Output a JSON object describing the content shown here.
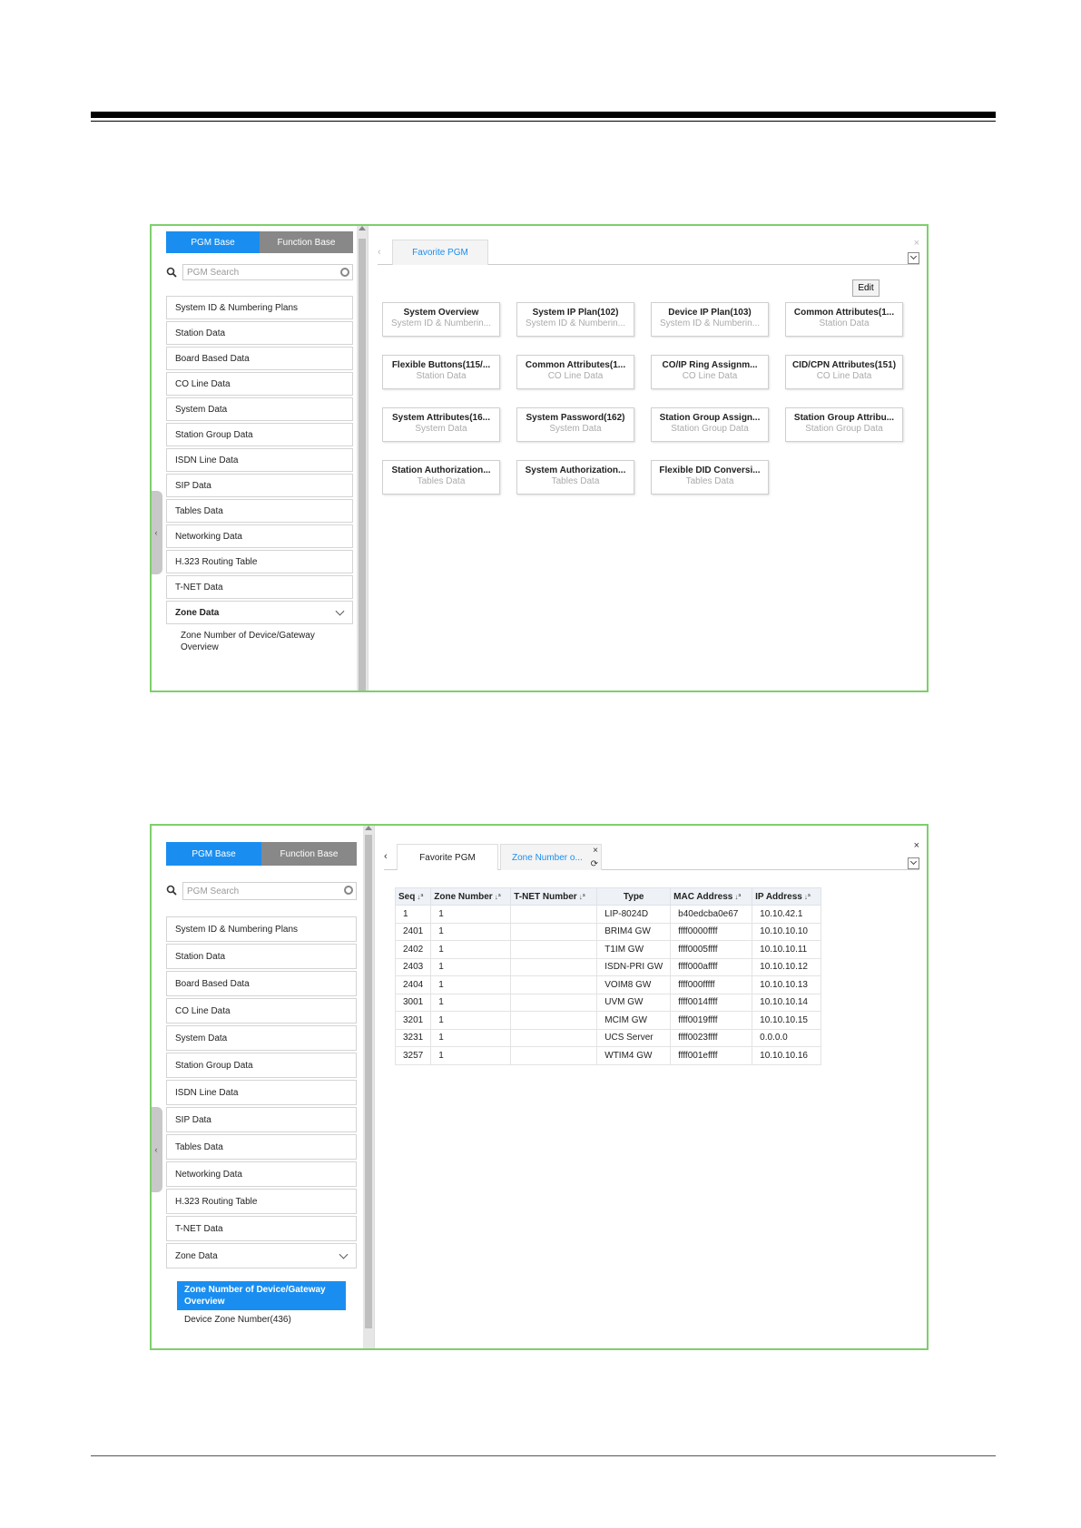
{
  "left_panel": {
    "tabs": [
      "PGM Base",
      "Function Base"
    ],
    "search_placeholder": "PGM Search",
    "menu": [
      "System ID & Numbering Plans",
      "Station Data",
      "Board Based Data",
      "CO Line Data",
      "System Data",
      "Station Group Data",
      "ISDN Line Data",
      "SIP Data",
      "Tables Data",
      "Networking Data",
      "H.323 Routing Table",
      "T-NET Data"
    ],
    "zone_menu": "Zone Data",
    "zone_sub": "Zone Number of Device/Gateway Overview",
    "zone_sub2": "Device Zone Number(436)"
  },
  "screen1": {
    "tab": "Favorite PGM",
    "edit_label": "Edit",
    "cards": [
      {
        "title": "System Overview",
        "subtitle": "System ID & Numberin..."
      },
      {
        "title": "System IP Plan(102)",
        "subtitle": "System ID & Numberin..."
      },
      {
        "title": "Device IP Plan(103)",
        "subtitle": "System ID & Numberin..."
      },
      {
        "title": "Common Attributes(1...",
        "subtitle": "Station Data"
      },
      {
        "title": "Flexible Buttons(115/...",
        "subtitle": "Station Data"
      },
      {
        "title": "Common Attributes(1...",
        "subtitle": "CO Line Data"
      },
      {
        "title": "CO/IP Ring Assignm...",
        "subtitle": "CO Line Data"
      },
      {
        "title": "CID/CPN Attributes(151)",
        "subtitle": "CO Line Data"
      },
      {
        "title": "System Attributes(16...",
        "subtitle": "System Data"
      },
      {
        "title": "System Password(162)",
        "subtitle": "System Data"
      },
      {
        "title": "Station Group Assign...",
        "subtitle": "Station Group Data"
      },
      {
        "title": "Station Group Attribu...",
        "subtitle": "Station Group Data"
      },
      {
        "title": "Station Authorization...",
        "subtitle": "Tables Data"
      },
      {
        "title": "System Authorization...",
        "subtitle": "Tables Data"
      },
      {
        "title": "Flexible DID Conversi...",
        "subtitle": "Tables Data"
      }
    ]
  },
  "screen2": {
    "tabs": [
      "Favorite PGM",
      "Zone Number o..."
    ],
    "table": {
      "columns": [
        "Seq",
        "Zone Number",
        "T-NET Number",
        "Type",
        "MAC Address",
        "IP Address"
      ],
      "rows": [
        [
          "1",
          "1",
          "",
          "LIP-8024D",
          "b40edcba0e67",
          "10.10.42.1"
        ],
        [
          "2401",
          "1",
          "",
          "BRIM4 GW",
          "ffff0000ffff",
          "10.10.10.10"
        ],
        [
          "2402",
          "1",
          "",
          "T1IM GW",
          "ffff0005ffff",
          "10.10.10.11"
        ],
        [
          "2403",
          "1",
          "",
          "ISDN-PRI GW",
          "ffff000affff",
          "10.10.10.12"
        ],
        [
          "2404",
          "1",
          "",
          "VOIM8 GW",
          "ffff000fffff",
          "10.10.10.13"
        ],
        [
          "3001",
          "1",
          "",
          "UVM GW",
          "ffff0014ffff",
          "10.10.10.14"
        ],
        [
          "3201",
          "1",
          "",
          "MCIM GW",
          "ffff0019ffff",
          "10.10.10.15"
        ],
        [
          "3231",
          "1",
          "",
          "UCS Server",
          "ffff0023ffff",
          "0.0.0.0"
        ],
        [
          "3257",
          "1",
          "",
          "WTIM4 GW",
          "ffff001effff",
          "10.10.10.16"
        ]
      ]
    }
  }
}
